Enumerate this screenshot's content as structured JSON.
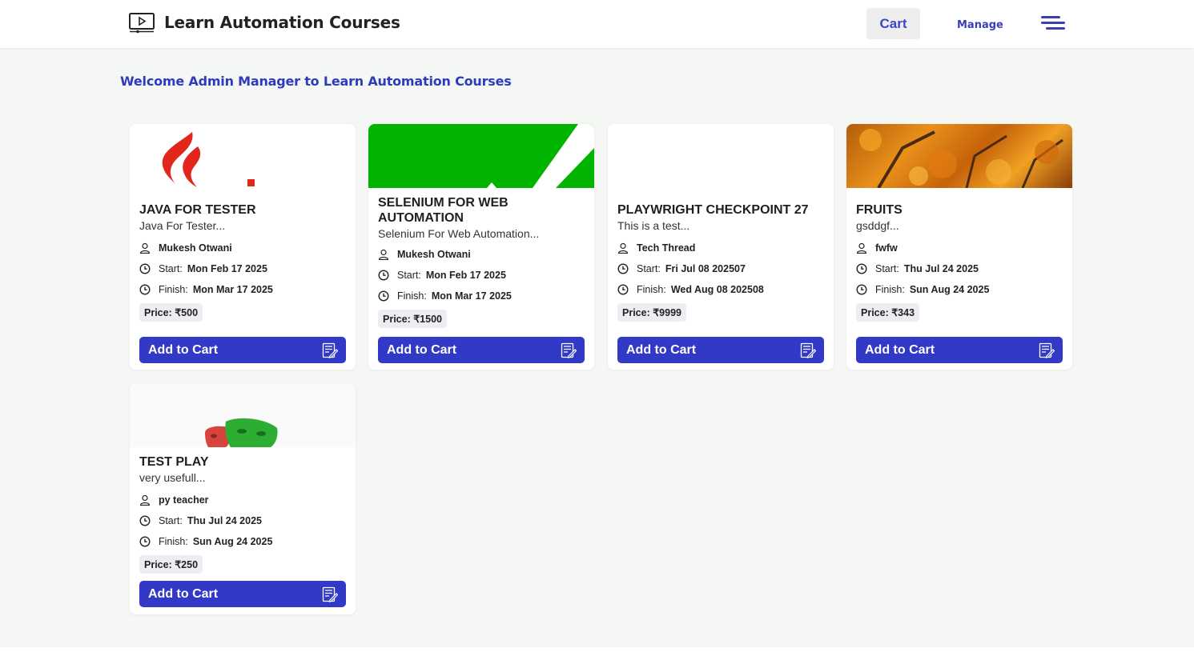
{
  "header": {
    "app_title": "Learn Automation Courses",
    "cart_label": "Cart",
    "manage_label": "Manage",
    "logo_icon": "video-screen-icon",
    "menu_icon": "hamburger-menu-icon"
  },
  "welcome_text": "Welcome Admin Manager to Learn Automation Courses",
  "colors": {
    "accent": "#3139c6",
    "link": "#2e3bbd"
  },
  "courses": [
    {
      "title": "JAVA FOR TESTER",
      "description": "Java For Tester...",
      "author": "Mukesh Otwani",
      "start_label": "Start:",
      "start": "Mon Feb 17 2025",
      "finish_label": "Finish:",
      "finish": "Mon Mar 17 2025",
      "price": "Price: ₹500",
      "button": "Add to Cart",
      "image": "java-logo"
    },
    {
      "title": "SELENIUM FOR WEB AUTOMATION",
      "description": "Selenium For Web Automation...",
      "author": "Mukesh Otwani",
      "start_label": "Start:",
      "start": "Mon Feb 17 2025",
      "finish_label": "Finish:",
      "finish": "Mon Mar 17 2025",
      "price": "Price: ₹1500",
      "button": "Add to Cart",
      "image": "selenium-logo"
    },
    {
      "title": "PLAYWRIGHT CHECKPOINT 27",
      "description": "This is a test...",
      "author": "Tech Thread",
      "start_label": "Start:",
      "start": "Fri Jul 08 202507",
      "finish_label": "Finish:",
      "finish": "Wed Aug 08 202508",
      "price": "Price: ₹9999",
      "button": "Add to Cart",
      "image": "blank"
    },
    {
      "title": "FRUITS",
      "description": "gsddgf...",
      "author": "fwfw",
      "start_label": "Start:",
      "start": "Thu Jul 24 2025",
      "finish_label": "Finish:",
      "finish": "Sun Aug 24 2025",
      "price": "Price: ₹343",
      "button": "Add to Cart",
      "image": "autumn-tree"
    },
    {
      "title": "TEST PLAY",
      "description": "very usefull...",
      "author": "py teacher",
      "start_label": "Start:",
      "start": "Thu Jul 24 2025",
      "finish_label": "Finish:",
      "finish": "Sun Aug 24 2025",
      "price": "Price: ₹250",
      "button": "Add to Cart",
      "image": "playwright-masks"
    }
  ]
}
